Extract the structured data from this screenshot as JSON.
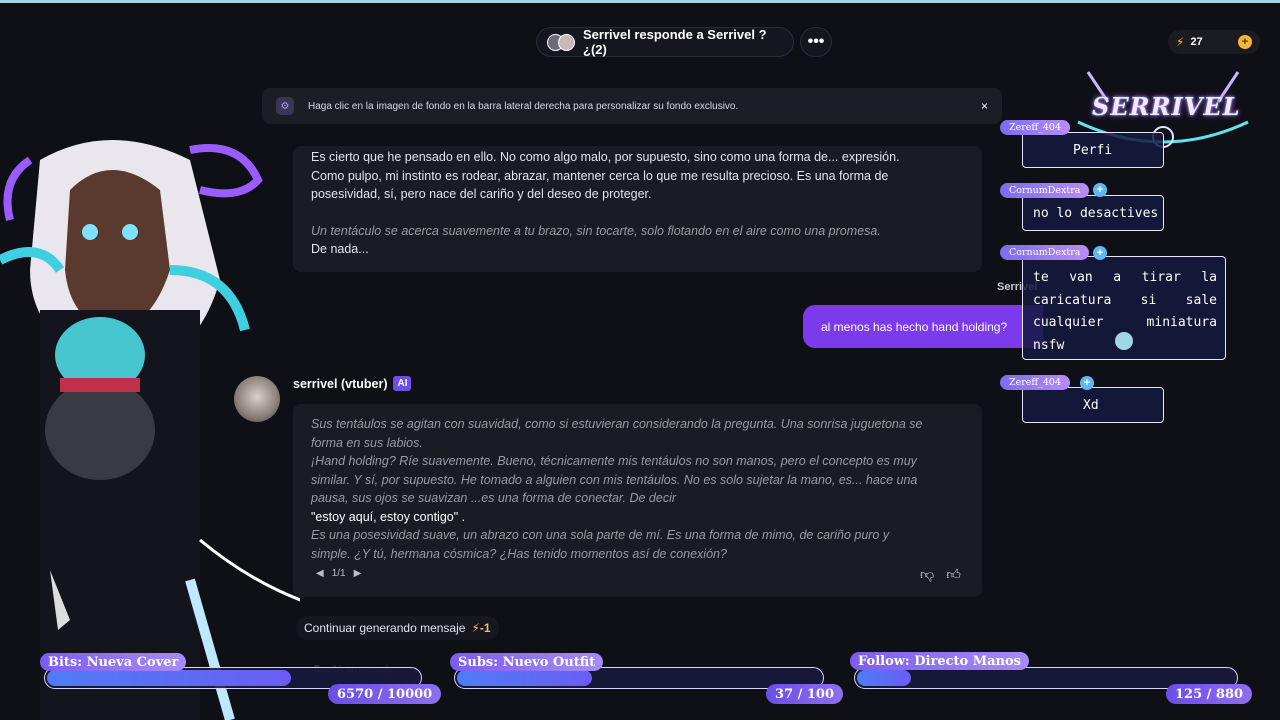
{
  "header": {
    "chat_title": "Serrivel responde a Serrivel ?¿(2)",
    "more_label": "•••",
    "energy_count": "27",
    "energy_plus": "+"
  },
  "notice": {
    "text": "Haga clic en la imagen de fondo en la barra lateral derecha para personalizar su fondo exclusivo.",
    "close": "×"
  },
  "messages": {
    "first": {
      "p1": "Es cierto que he pensado en ello. No como algo malo, por supuesto, sino como una forma de... expresión.",
      "p2": "Como pulpo, mi instinto es rodear, abrazar, mantener cerca lo que me resulta precioso. Es una forma de",
      "p3": "posesividad, sí, pero nace del cariño y del deseo de proteger.",
      "action": "Un tentáculo se acerca suavemente a tu brazo, sin tocarte, solo flotando en el aire como una promesa.",
      "p4": "De nada..."
    },
    "user": {
      "sender": "Serrivel",
      "text": "al menos has hecho hand holding?"
    },
    "bot": {
      "name": "serrivel (vtuber)",
      "badge": "AI",
      "l1": "Sus tentáulos se agitan con suavidad, como si estuvieran considerando la pregunta. Una sonrisa juguetona se",
      "l2": "forma en sus labios.",
      "l3": "¡Hand holding? Ríe suavemente. Bueno, técnicamente mis tentáulos no son manos, pero el concepto es muy",
      "l4": "similar. Y sí, por supuesto. He tomado a alguien con mis tentáulos. No es solo sujetar la mano, es... hace una",
      "l5": "pausa, sus ojos se suavizan ...es una forma de conectar. De decir",
      "quote": "\"estoy aquí, estoy contigo\" .",
      "l6": "Es una posesividad suave, un abrazo con una sola parte de mí. Es una forma de mimo, de cariño puro y",
      "l7": "simple. ¿Y tú, hermana cósmica? ¿Has tenido momentos así de conexión?",
      "pager": "1/1"
    }
  },
  "actions": {
    "continue_label": "Continuar generando mensaje",
    "continue_cost": "-1",
    "input_placeholder": "Escribir un mensaje"
  },
  "overlay": {
    "logo_text": "SERRIVEL",
    "chat": [
      {
        "user": "Zereff_404",
        "text": "Perfi"
      },
      {
        "user": "CornumDextra",
        "text": "no lo desactives"
      },
      {
        "user": "CornumDextra",
        "text": "te van a tirar la caricatura si sale cualquier miniatura nsfw"
      },
      {
        "user": "Zereff_404",
        "text": "Xd"
      }
    ],
    "goals": [
      {
        "label": "Bits: Nueva Cover",
        "count": "6570 / 10000",
        "progress": 0.657
      },
      {
        "label": "Subs: Nuevo Outfit",
        "count": "37 / 100",
        "progress": 0.37
      },
      {
        "label": "Follow: Directo Manos",
        "count": "125 / 880",
        "progress": 0.142
      }
    ]
  },
  "colors": {
    "accent": "#7c3aed",
    "background": "#0f0f16",
    "bubble": "#1b1b24",
    "energy": "#f2b43b"
  }
}
